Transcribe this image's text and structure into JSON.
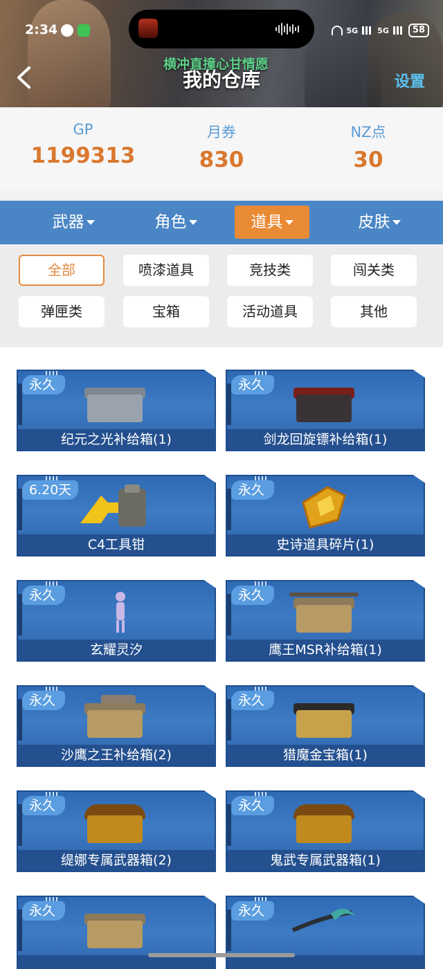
{
  "status": {
    "time": "2:34",
    "network_a": "5G",
    "network_b": "5G",
    "battery": "58"
  },
  "header": {
    "title": "我的仓库",
    "marquee": "横冲直撞心甘情愿",
    "settings_label": "设置"
  },
  "currency": [
    {
      "label": "GP",
      "value": "1199313"
    },
    {
      "label": "月券",
      "value": "830"
    },
    {
      "label": "NZ点",
      "value": "30"
    }
  ],
  "tabs": [
    {
      "label": "武器",
      "active": false
    },
    {
      "label": "角色",
      "active": false
    },
    {
      "label": "道具",
      "active": true
    },
    {
      "label": "皮肤",
      "active": false
    }
  ],
  "filters": [
    {
      "label": "全部",
      "active": true
    },
    {
      "label": "喷漆道具",
      "active": false
    },
    {
      "label": "竞技类",
      "active": false
    },
    {
      "label": "闯关类",
      "active": false
    },
    {
      "label": "弹匣类",
      "active": false
    },
    {
      "label": "宝箱",
      "active": false
    },
    {
      "label": "活动道具",
      "active": false
    },
    {
      "label": "其他",
      "active": false
    }
  ],
  "items": [
    {
      "badge": "永久",
      "name": "纪元之光补给箱(1)",
      "icon": "supply-crate-silver-icon",
      "color": "#9aa3ad"
    },
    {
      "badge": "永久",
      "name": "剑龙回旋镖补给箱(1)",
      "icon": "supply-crate-dark-icon",
      "color": "#3a3336"
    },
    {
      "badge": "6.20天",
      "name": "C4工具钳",
      "icon": "c4-pliers-icon",
      "color": "#6b6b63"
    },
    {
      "badge": "永久",
      "name": "史诗道具碎片(1)",
      "icon": "epic-fragment-icon",
      "color": "#e0a21a"
    },
    {
      "badge": "永久",
      "name": "玄耀灵汐",
      "icon": "character-figure-icon",
      "color": "#c9b7e6"
    },
    {
      "badge": "永久",
      "name": "鹰王MSR补给箱(1)",
      "icon": "sniper-crate-icon",
      "color": "#b79a64"
    },
    {
      "badge": "永久",
      "name": "沙鹰之王补给箱(2)",
      "icon": "pistol-crate-icon",
      "color": "#b79a64"
    },
    {
      "badge": "永久",
      "name": "猎魔金宝箱(1)",
      "icon": "gold-chest-icon",
      "color": "#c7a24a"
    },
    {
      "badge": "永久",
      "name": "缇娜专属武器箱(2)",
      "icon": "weapon-chest-icon",
      "color": "#c08a1e"
    },
    {
      "badge": "永久",
      "name": "鬼武专属武器箱(1)",
      "icon": "weapon-chest-icon",
      "color": "#c08a1e"
    },
    {
      "badge": "永久",
      "name": "",
      "icon": "weapon-crate-icon",
      "color": "#b79a64"
    },
    {
      "badge": "永久",
      "name": "",
      "icon": "scythe-weapon-icon",
      "color": "#3fa9a0"
    }
  ]
}
